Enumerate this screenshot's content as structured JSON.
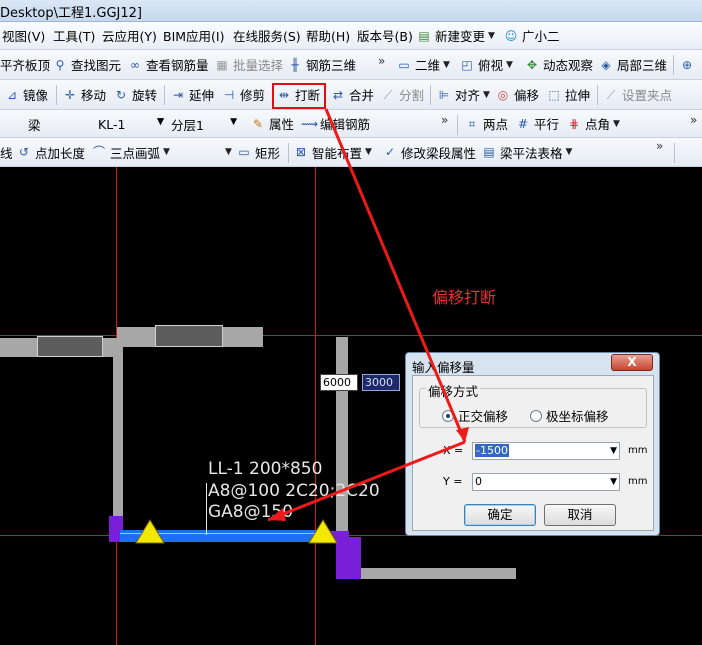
{
  "window": {
    "title": "Desktop\\工程1.GGJ12]"
  },
  "menu": {
    "items": [
      "视图(V)",
      "工具(T)",
      "云应用(Y)",
      "BIM应用(I)",
      "在线服务(S)",
      "帮助(H)",
      "版本号(B)"
    ],
    "new_change": "新建变更",
    "assistant": "广小二"
  },
  "toolbar1": {
    "align_top": "平齐板顶",
    "find_element": "查找图元",
    "view_rebar_qty": "查看钢筋量",
    "batch_select": "批量选择",
    "rebar_3d": "钢筋三维",
    "view_2d": "二维",
    "top_view": "俯视",
    "dynamic_observe": "动态观察",
    "local_3d": "局部三维"
  },
  "toolbar2": {
    "mirror": "镜像",
    "move": "移动",
    "rotate": "旋转",
    "extend": "延伸",
    "trim": "修剪",
    "break": "打断",
    "merge": "合并",
    "split": "分割",
    "align": "对齐",
    "offset": "偏移",
    "stretch": "拉伸",
    "set_grip": "设置夹点"
  },
  "toolbar3": {
    "type": "梁",
    "name": "KL-1",
    "floor": "分层1",
    "properties": "属性",
    "edit_rebar": "编辑钢筋",
    "two_points": "两点",
    "parallel": "平行",
    "point_angle": "点角"
  },
  "toolbar4": {
    "line": "线",
    "point_extend": "点加长度",
    "three_point_arc": "三点画弧",
    "rectangle": "矩形",
    "smart_layout": "智能布置",
    "modify_span_props": "修改梁段属性",
    "beam_table": "梁平法表格"
  },
  "canvas": {
    "annotation": "偏移打断",
    "beam_label_lines": [
      "LL-1 200*850",
      "A8@100 2C20;2C20",
      "GA8@150"
    ],
    "length_input_1": "6000",
    "length_input_2": "3000"
  },
  "dialog": {
    "title": "输入偏移量",
    "close": "X",
    "group_label": "偏移方式",
    "radio_orthogonal": "正交偏移",
    "radio_polar": "极坐标偏移",
    "x_label": "X =",
    "x_value": "-1500",
    "y_label": "Y =",
    "y_value": "0",
    "unit": "mm",
    "ok": "确定",
    "cancel": "取消"
  },
  "colors": {
    "grid_line": "#d01818",
    "beam_highlight": "#1d70e8",
    "beam_end": "#7a1fd8",
    "grip": "#f3e800",
    "arrow": "#ee1a1a"
  }
}
